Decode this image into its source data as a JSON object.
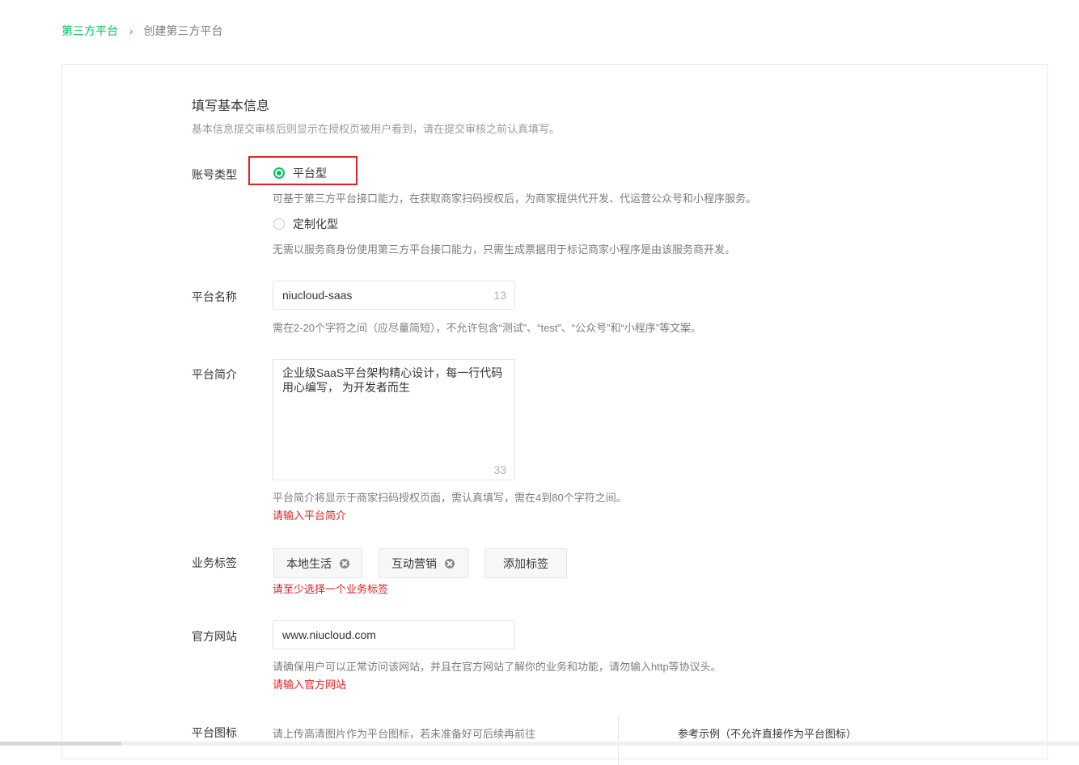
{
  "breadcrumb": {
    "parent": "第三方平台",
    "separator": "›",
    "current": "创建第三方平台"
  },
  "form": {
    "section_title": "填写基本信息",
    "section_desc": "基本信息提交审核后则显示在授权页被用户看到，请在提交审核之前认真填写。",
    "account_type": {
      "label": "账号类型",
      "options": [
        {
          "label": "平台型",
          "selected": true,
          "desc": "可基于第三方平台接口能力，在获取商家扫码授权后，为商家提供代开发、代运营公众号和小程序服务。"
        },
        {
          "label": "定制化型",
          "selected": false,
          "desc": "无需以服务商身份使用第三方平台接口能力，只需生成票据用于标记商家小程序是由该服务商开发。"
        }
      ]
    },
    "platform_name": {
      "label": "平台名称",
      "value": "niucloud-saas",
      "count": "13",
      "hint": "需在2-20个字符之间（应尽量简短），不允许包含“测试”、“test”、“公众号”和“小程序”等文案。"
    },
    "platform_intro": {
      "label": "平台简介",
      "value": "企业级SaaS平台架构精心设计，每一行代码\n用心编写， 为开发者而生",
      "count": "33",
      "hint": "平台简介将显示于商家扫码授权页面，需认真填写，需在4到80个字符之间。",
      "error": "请输入平台简介"
    },
    "business_tags": {
      "label": "业务标签",
      "tags": [
        "本地生活",
        "互动营销"
      ],
      "add_label": "添加标签",
      "error": "请至少选择一个业务标签"
    },
    "website": {
      "label": "官方网站",
      "value": "www.niucloud.com",
      "hint": "请确保用户可以正常访问该网站，并且在官方网站了解你的业务和功能，请勿输入http等协议头。",
      "error": "请输入官方网站"
    },
    "platform_icon": {
      "label": "平台图标",
      "hint": "请上传高清图片作为平台图标，若未准备好可后续再前往",
      "example_title": "参考示例（不允许直接作为平台图标）"
    }
  },
  "colors": {
    "accent": "#07c160",
    "error": "#e02424",
    "highlight_border": "#e02424"
  }
}
